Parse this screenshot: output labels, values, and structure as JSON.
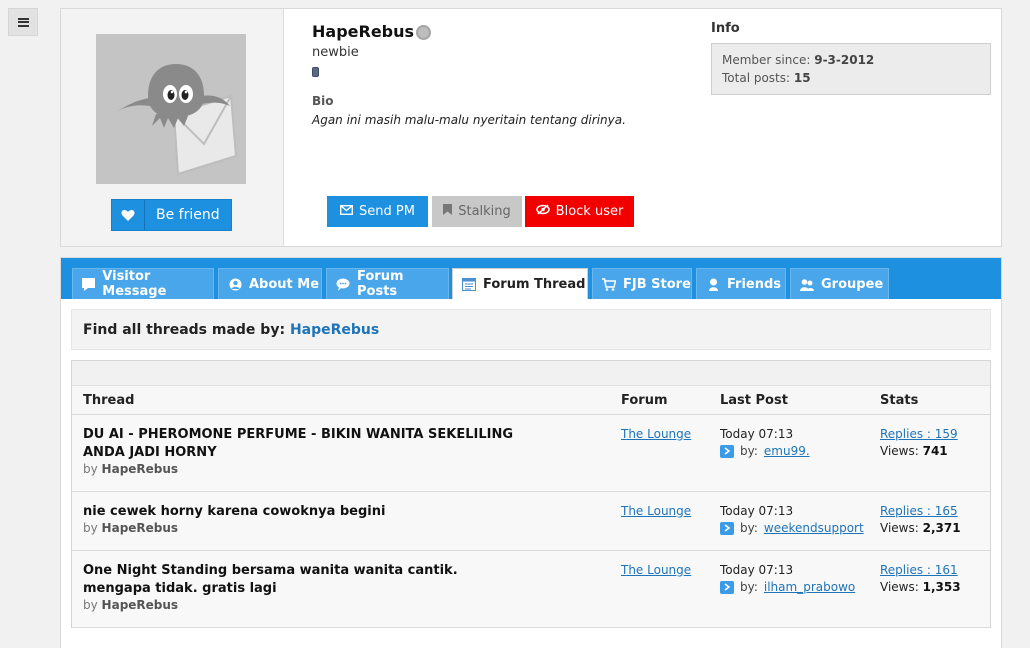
{
  "profile": {
    "username": "HapeRebus",
    "rank": "newbie",
    "bio_heading": "Bio",
    "bio_text": "Agan ini masih malu-malu nyeritain tentang dirinya.",
    "befriend_label": "Be friend",
    "buttons": {
      "send_pm": "Send PM",
      "stalking": "Stalking",
      "block_user": "Block user"
    },
    "info": {
      "heading": "Info",
      "member_since_label": "Member since:",
      "member_since_value": "9-3-2012",
      "total_posts_label": "Total posts:",
      "total_posts_value": "15"
    }
  },
  "tabs": [
    {
      "label": "Visitor Message",
      "icon": "message-icon"
    },
    {
      "label": "About Me",
      "icon": "user-icon"
    },
    {
      "label": "Forum Posts",
      "icon": "speech-bubble-icon"
    },
    {
      "label": "Forum Thread",
      "icon": "calendar-list-icon",
      "active": true
    },
    {
      "label": "FJB Store",
      "icon": "cart-icon"
    },
    {
      "label": "Friends",
      "icon": "friend-icon"
    },
    {
      "label": "Groupee",
      "icon": "group-icon"
    }
  ],
  "find": {
    "label": "Find all threads made by:",
    "user": "HapeRebus"
  },
  "table": {
    "headers": {
      "thread": "Thread",
      "forum": "Forum",
      "last_post": "Last Post",
      "stats": "Stats"
    },
    "rows": [
      {
        "title": "DU AI - PHEROMONE PERFUME - BIKIN WANITA SEKELILING ANDA JADI HORNY",
        "by_label": "by",
        "author": "HapeRebus",
        "forum": "The Lounge",
        "last_post_time": "Today 07:13",
        "last_post_by_label": "by:",
        "last_post_user": "emu99.",
        "replies": "Replies : 159",
        "views_label": "Views:",
        "views": "741"
      },
      {
        "title": "nie cewek horny karena cowoknya begini",
        "by_label": "by",
        "author": "HapeRebus",
        "forum": "The Lounge",
        "last_post_time": "Today 07:13",
        "last_post_by_label": "by:",
        "last_post_user": "weekendsupport",
        "replies": "Replies : 165",
        "views_label": "Views:",
        "views": "2,371"
      },
      {
        "title": "One Night Standing bersama wanita wanita cantik. mengapa tidak. gratis lagi",
        "by_label": "by",
        "author": "HapeRebus",
        "forum": "The Lounge",
        "last_post_time": "Today 07:13",
        "last_post_by_label": "by:",
        "last_post_user": "ilham_prabowo",
        "replies": "Replies : 161",
        "views_label": "Views:",
        "views": "1,353"
      }
    ]
  },
  "colors": {
    "accent_blue": "#1e90e0",
    "block_red": "#f20000",
    "link_blue": "#1e74b8"
  }
}
